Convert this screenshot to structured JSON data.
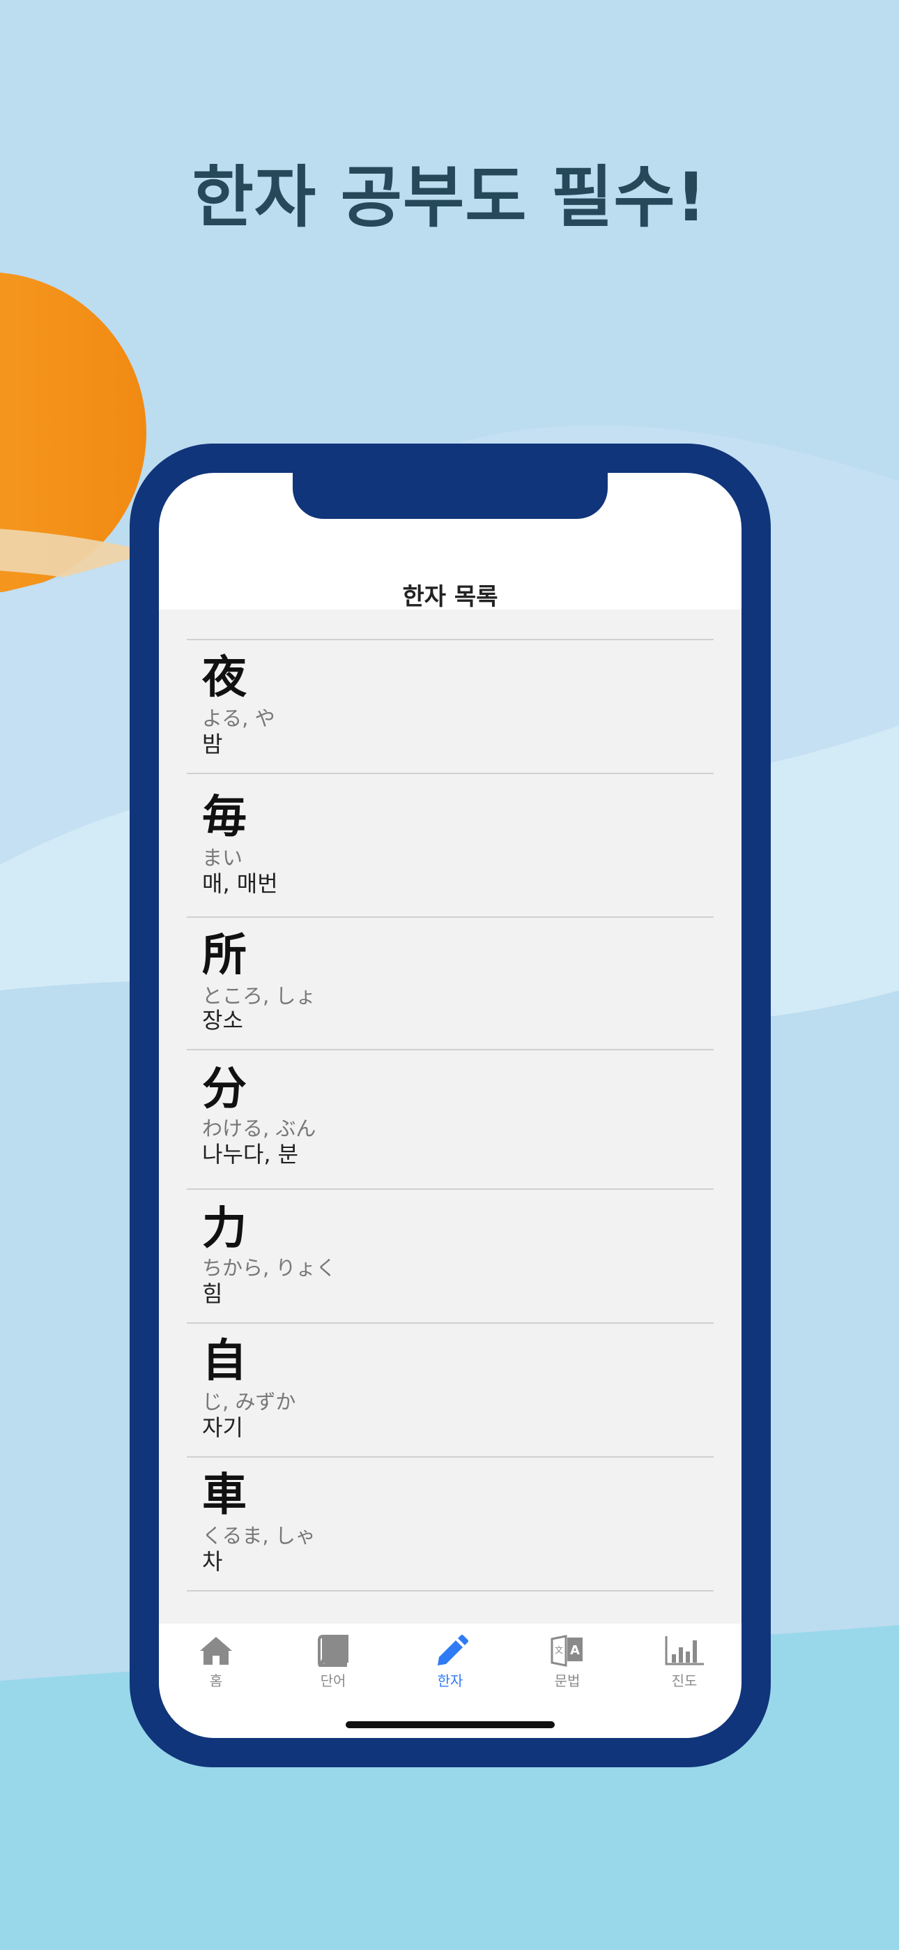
{
  "headline": "한자 공부도 필수!",
  "screen": {
    "title": "한자 목록",
    "kanji_list": [
      {
        "kanji": "夜",
        "reading": "よる, や",
        "meaning": "밤"
      },
      {
        "kanji": "毎",
        "reading": "まい",
        "meaning": "매, 매번"
      },
      {
        "kanji": "所",
        "reading": "ところ, しょ",
        "meaning": "장소"
      },
      {
        "kanji": "分",
        "reading": "わける, ぶん",
        "meaning": "나누다, 분"
      },
      {
        "kanji": "力",
        "reading": "ちから, りょく",
        "meaning": "힘"
      },
      {
        "kanji": "自",
        "reading": "じ, みずか",
        "meaning": "자기"
      },
      {
        "kanji": "車",
        "reading": "くるま, しゃ",
        "meaning": "차"
      }
    ]
  },
  "tabbar": {
    "tabs": [
      {
        "label": "홈",
        "icon": "home-icon",
        "active": false
      },
      {
        "label": "단어",
        "icon": "book-icon",
        "active": false
      },
      {
        "label": "한자",
        "icon": "pencil-icon",
        "active": true
      },
      {
        "label": "문법",
        "icon": "translate-icon",
        "active": false
      },
      {
        "label": "진도",
        "icon": "bar-chart-icon",
        "active": false
      }
    ]
  },
  "colors": {
    "sky": "#bcdcf0",
    "sun": "#f7941d",
    "phone_frame": "#10357a",
    "active_tab": "#2f7bf5",
    "headline": "#26495a"
  }
}
